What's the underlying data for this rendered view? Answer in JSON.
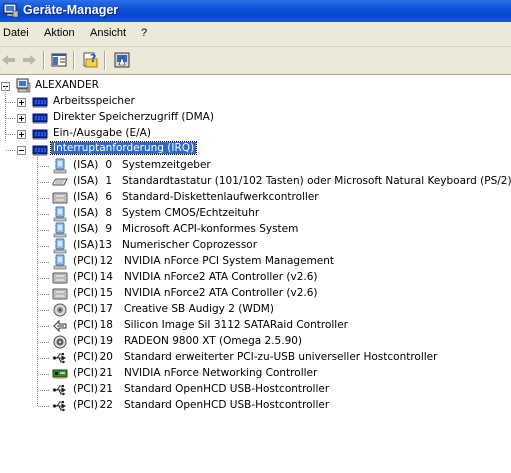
{
  "window": {
    "title": "Geräte-Manager"
  },
  "menu": [
    {
      "label": "Datei"
    },
    {
      "label": "Aktion"
    },
    {
      "label": "Ansicht"
    },
    {
      "label": "?"
    }
  ],
  "toolbar": {
    "buttons": [
      {
        "name": "back-arrow-icon"
      },
      {
        "name": "forward-arrow-icon"
      },
      {
        "name": "show-hide-console-tree-icon"
      },
      {
        "name": "properties-help-icon"
      },
      {
        "name": "computer-properties-icon"
      }
    ]
  },
  "tree": {
    "root": {
      "label": "ALEXANDER",
      "icon": "computer-icon"
    },
    "categories": [
      {
        "label": "Arbeitsspeicher",
        "icon": "memory-icon",
        "expanded": false
      },
      {
        "label": "Direkter Speicherzugriff (DMA)",
        "icon": "memory-icon",
        "expanded": false
      },
      {
        "label": "Ein-/Ausgabe (E/A)",
        "icon": "memory-icon",
        "expanded": false
      },
      {
        "label": "Interruptanforderung (IRQ)",
        "icon": "memory-icon",
        "expanded": true,
        "selected": true
      }
    ],
    "irq_items": [
      {
        "bus": "(ISA)",
        "irq": "0",
        "name": "Systemzeitgeber",
        "icon": "system-device-icon"
      },
      {
        "bus": "(ISA)",
        "irq": "1",
        "name": "Standardtastatur (101/102 Tasten) oder Microsoft Natural Keyboard (PS/2)",
        "icon": "keyboard-icon"
      },
      {
        "bus": "(ISA)",
        "irq": "6",
        "name": "Standard-Diskettenlaufwerkcontroller",
        "icon": "disk-controller-icon"
      },
      {
        "bus": "(ISA)",
        "irq": "8",
        "name": "System CMOS/Echtzeituhr",
        "icon": "system-device-icon"
      },
      {
        "bus": "(ISA)",
        "irq": "9",
        "name": "Microsoft ACPI-konformes System",
        "icon": "system-device-icon"
      },
      {
        "bus": "(ISA)",
        "irq": "13",
        "name": "Numerischer Coprozessor",
        "icon": "system-device-icon"
      },
      {
        "bus": "(PCI)",
        "irq": "12",
        "name": "NVIDIA nForce PCI System Management",
        "icon": "system-device-icon"
      },
      {
        "bus": "(PCI)",
        "irq": "14",
        "name": "NVIDIA nForce2 ATA Controller (v2.6)",
        "icon": "disk-controller-icon"
      },
      {
        "bus": "(PCI)",
        "irq": "15",
        "name": "NVIDIA nForce2 ATA Controller (v2.6)",
        "icon": "disk-controller-icon"
      },
      {
        "bus": "(PCI)",
        "irq": "17",
        "name": "Creative SB Audigy 2 (WDM)",
        "icon": "sound-icon"
      },
      {
        "bus": "(PCI)",
        "irq": "18",
        "name": "Silicon Image SiI 3112 SATARaid Controller",
        "icon": "scsi-controller-icon"
      },
      {
        "bus": "(PCI)",
        "irq": "19",
        "name": "RADEON 9800 XT (Omega 2.5.90)",
        "icon": "display-icon"
      },
      {
        "bus": "(PCI)",
        "irq": "20",
        "name": "Standard erweiterter PCI-zu-USB universeller Hostcontroller",
        "icon": "usb-icon"
      },
      {
        "bus": "(PCI)",
        "irq": "21",
        "name": "NVIDIA nForce Networking Controller",
        "icon": "network-card-icon"
      },
      {
        "bus": "(PCI)",
        "irq": "21",
        "name": "Standard OpenHCD USB-Hostcontroller",
        "icon": "usb-icon"
      },
      {
        "bus": "(PCI)",
        "irq": "22",
        "name": "Standard OpenHCD USB-Hostcontroller",
        "icon": "usb-icon"
      }
    ]
  },
  "colors": {
    "titlebar": "#0a4fd4",
    "selection": "#316ac5",
    "chrome": "#ece9d8"
  }
}
